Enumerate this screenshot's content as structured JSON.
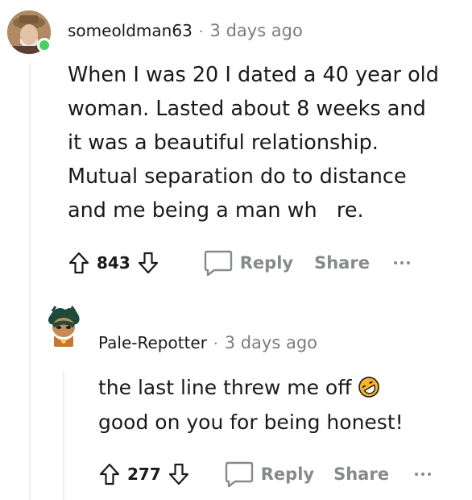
{
  "comments": [
    {
      "username": "someoldman63",
      "separator": "·",
      "time": "3 days ago",
      "body_lines": [
        "When I was 20 I dated a 40 year old",
        "woman. Lasted about 8 weeks and",
        "it was a beautiful relationship.",
        "Mutual separation do to distance",
        "and me being a man wh   re."
      ],
      "score": "843",
      "reply_label": "Reply",
      "share_label": "Share"
    },
    {
      "username": "Pale-Repotter",
      "separator": "·",
      "time": "3 days ago",
      "body_lines": [
        "the last line threw me off",
        "good on you for being honest!"
      ],
      "emoji": "rolling-on-floor-laughing-emoji",
      "score": "277",
      "reply_label": "Reply",
      "share_label": "Share"
    }
  ],
  "colors": {
    "online": "#46d160",
    "meta": "#7c7c7c",
    "action": "#878a8c",
    "thread_line": "#edeff1",
    "emoji": "#f7b52c"
  }
}
